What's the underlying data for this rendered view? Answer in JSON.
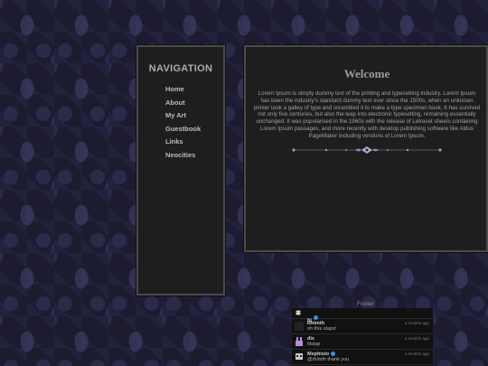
{
  "navigation": {
    "title": "NAVIGATION",
    "items": [
      {
        "label": "Home"
      },
      {
        "label": "About"
      },
      {
        "label": "My Art"
      },
      {
        "label": "Guestbook"
      },
      {
        "label": "Links"
      },
      {
        "label": "Neocities"
      }
    ]
  },
  "main": {
    "title": "Welcome",
    "body": "Lorem Ipsum is simply dummy text of the printing and typesetting industry. Lorem Ipsum has been the industry's standard dummy text ever since the 1500s, when an unknown printer took a galley of type and scrambled it to make a type specimen book. It has survived not only five centuries, but also the leap into electronic typesetting, remaining essentially unchanged. It was popularised in the 1960s with the release of Letraset sheets containing Lorem Ipsum passages, and more recently with desktop publishing software like Aldus PageMaker including versions of Lorem Ipsum."
  },
  "footer": {
    "label": "Footer",
    "messages": [
      {
        "user": "hi",
        "time": "",
        "text": ""
      },
      {
        "user": "Rhimth",
        "time": "a months ago",
        "text": "oh this slaps!"
      },
      {
        "user": "dix",
        "time": "a months ago",
        "text": "titslap"
      },
      {
        "user": "Mephisto",
        "time": "a months ago",
        "text": "@rhimth thank you"
      }
    ]
  },
  "colors": {
    "page_background": "#1c1b30",
    "panel_background": "#1e1e1e",
    "panel_border": "#4a4a4a"
  }
}
